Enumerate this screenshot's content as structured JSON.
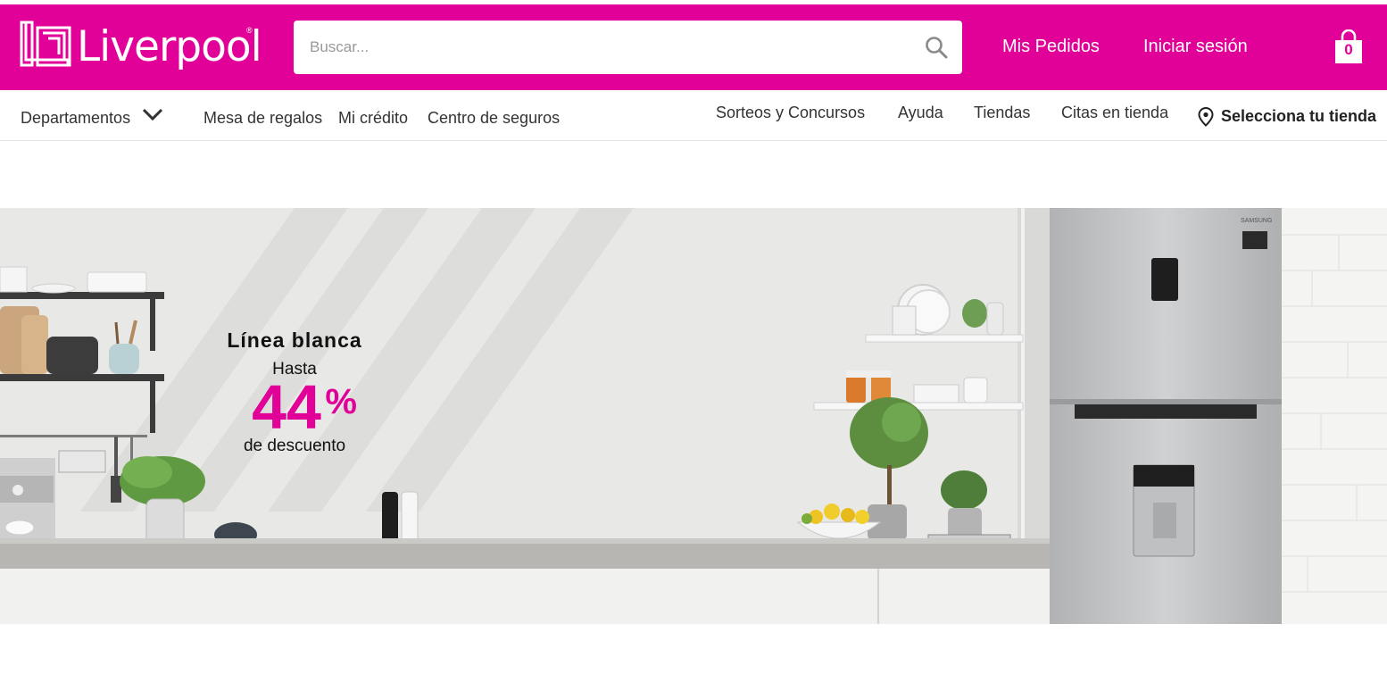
{
  "header": {
    "logo_text": "Liverpool",
    "logo_mark": "®",
    "search_placeholder": "Buscar...",
    "links": {
      "orders": "Mis Pedidos",
      "login": "Iniciar sesión"
    },
    "cart_count": "0",
    "colors": {
      "brand": "#e10098"
    }
  },
  "subnav": {
    "departments": "Departamentos",
    "left_links": [
      "Mesa de regalos",
      "Mi crédito",
      "Centro de seguros"
    ],
    "right_links": [
      "Sorteos y Concursos",
      "Ayuda",
      "Tiendas",
      "Citas en tienda"
    ],
    "store_selector": "Selecciona tu tienda"
  },
  "banner": {
    "title": "Línea blanca",
    "pre": "Hasta",
    "discount_value": "44",
    "discount_unit": "%",
    "post": "de descuento",
    "fridge_brand": "SAMSUNG"
  }
}
